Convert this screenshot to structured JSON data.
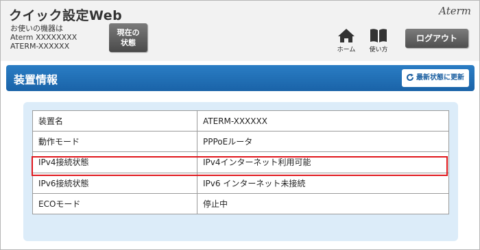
{
  "header": {
    "app_title": "クイック設定Web",
    "device_label_1": "お使いの機器は",
    "device_label_2": "Aterm XXXXXXXX",
    "device_label_3": "ATERM-XXXXXX",
    "status_button_line1": "現在の",
    "status_button_line2": "状態",
    "brand": "Aterm",
    "nav_home_label": "ホーム",
    "nav_guide_label": "使い方",
    "logout_label": "ログアウト"
  },
  "section": {
    "title": "装置情報",
    "refresh_label": "最新状態に更新"
  },
  "table": {
    "rows": [
      {
        "key": "装置名",
        "value": "ATERM-XXXXXX"
      },
      {
        "key": "動作モード",
        "value": "PPPoEルータ"
      },
      {
        "key": "IPv4接続状態",
        "value": "IPv4インターネット利用可能"
      },
      {
        "key": "IPv6接続状態",
        "value": "IPv6 インターネット未接続"
      },
      {
        "key": "ECOモード",
        "value": "停止中"
      }
    ],
    "highlighted_row": "IPv4接続状態"
  },
  "colors": {
    "section_bar": "#1f6fb8",
    "panel_bg": "#dcecf9",
    "highlight": "#e0161b",
    "button_dark": "#5a5a5a"
  },
  "icons": {
    "home": "home-icon",
    "guide": "book-icon",
    "refresh": "refresh-icon"
  }
}
